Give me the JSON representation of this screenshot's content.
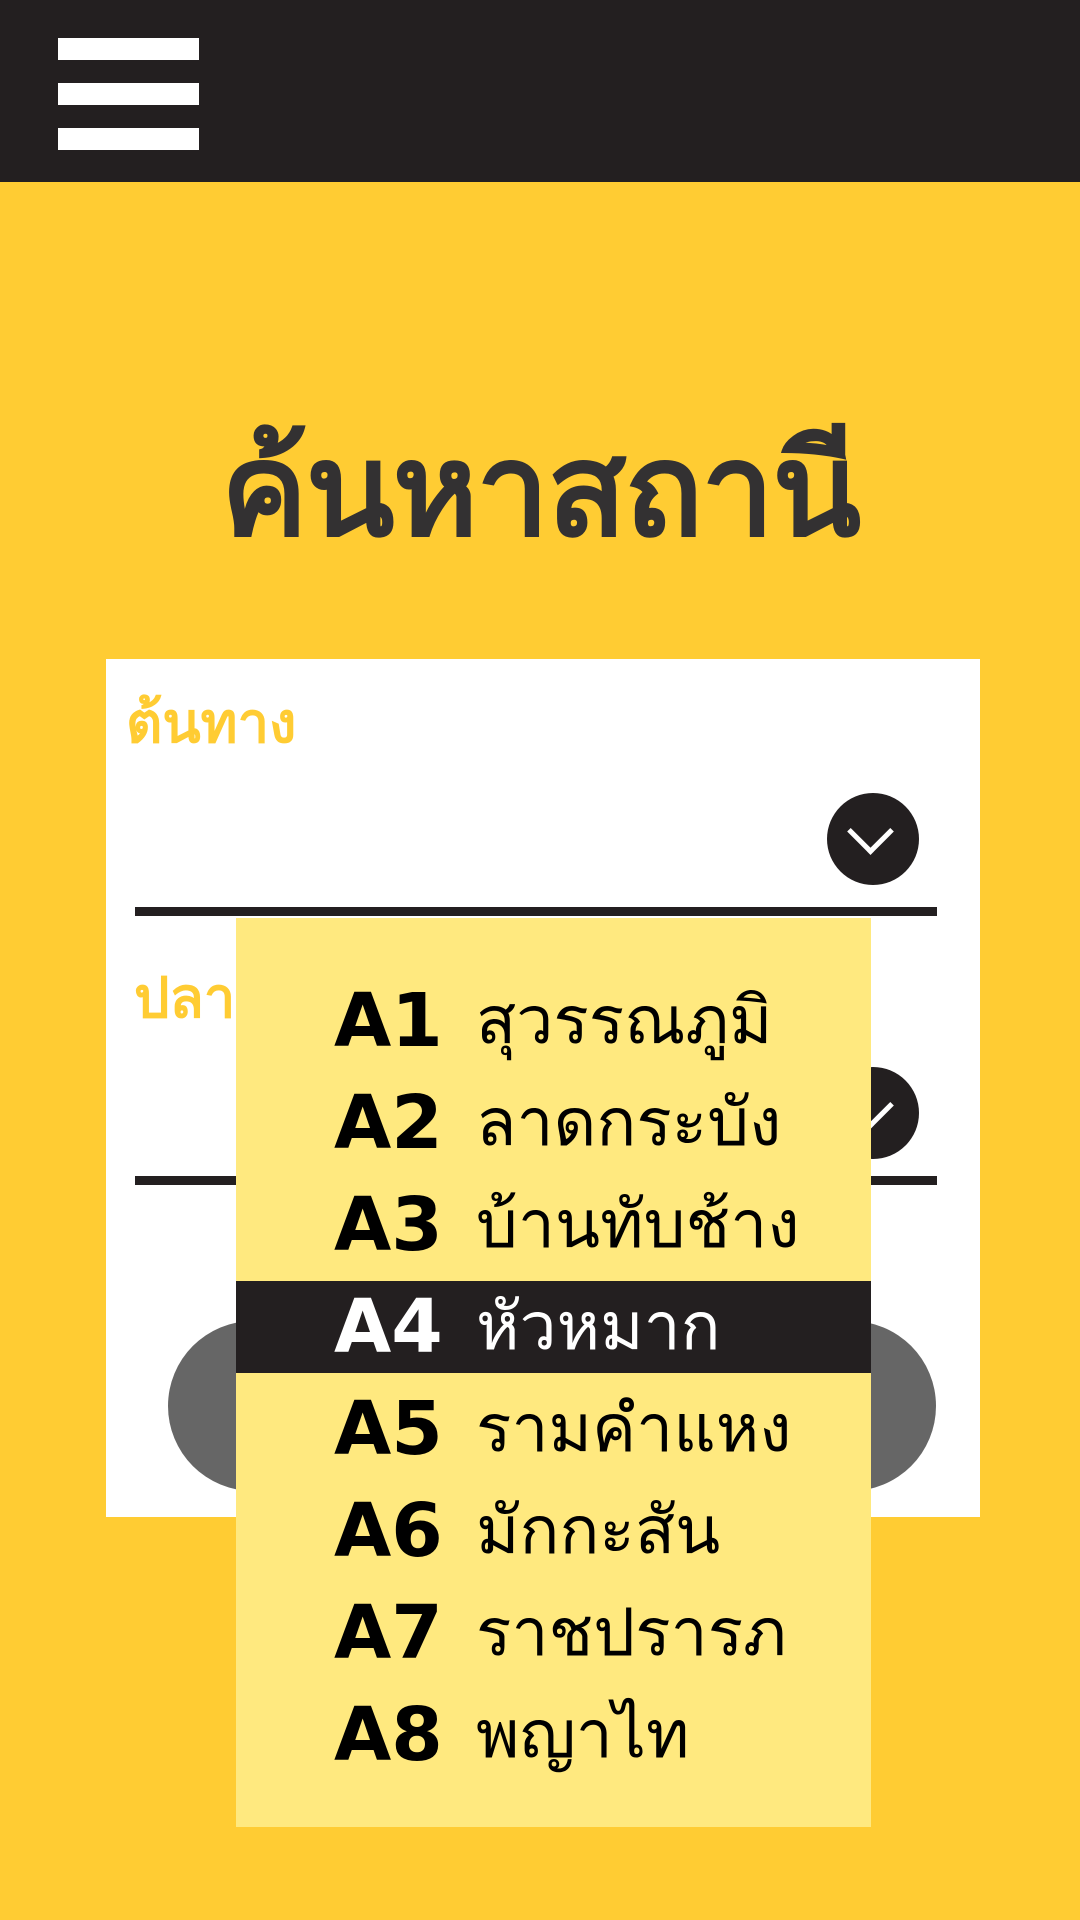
{
  "header": {
    "menu_icon": "hamburger-menu-icon"
  },
  "page": {
    "title": "ค้นหาสถานี"
  },
  "form": {
    "origin_label": "ต้นทาง",
    "origin_value": "",
    "destination_label": "ปลา",
    "destination_value": "",
    "dropdown_icon": "chevron-down-icon",
    "search_label": ""
  },
  "stations": [
    {
      "code": "A1",
      "name": "สุวรรณภูมิ"
    },
    {
      "code": "A2",
      "name": "ลาดกระบัง"
    },
    {
      "code": "A3",
      "name": "บ้านทับช้าง"
    },
    {
      "code": "A4",
      "name": "หัวหมาก"
    },
    {
      "code": "A5",
      "name": "รามคำแหง"
    },
    {
      "code": "A6",
      "name": "มักกะสัน"
    },
    {
      "code": "A7",
      "name": "ราชปรารภ"
    },
    {
      "code": "A8",
      "name": "พญาไท"
    }
  ],
  "selected_station": "A4",
  "colors": {
    "background": "#FFCC33",
    "topbar": "#231F20",
    "list_background": "#FFE97F",
    "selected_row": "#231F20",
    "title_text": "#333132",
    "search_button": "#666666"
  }
}
